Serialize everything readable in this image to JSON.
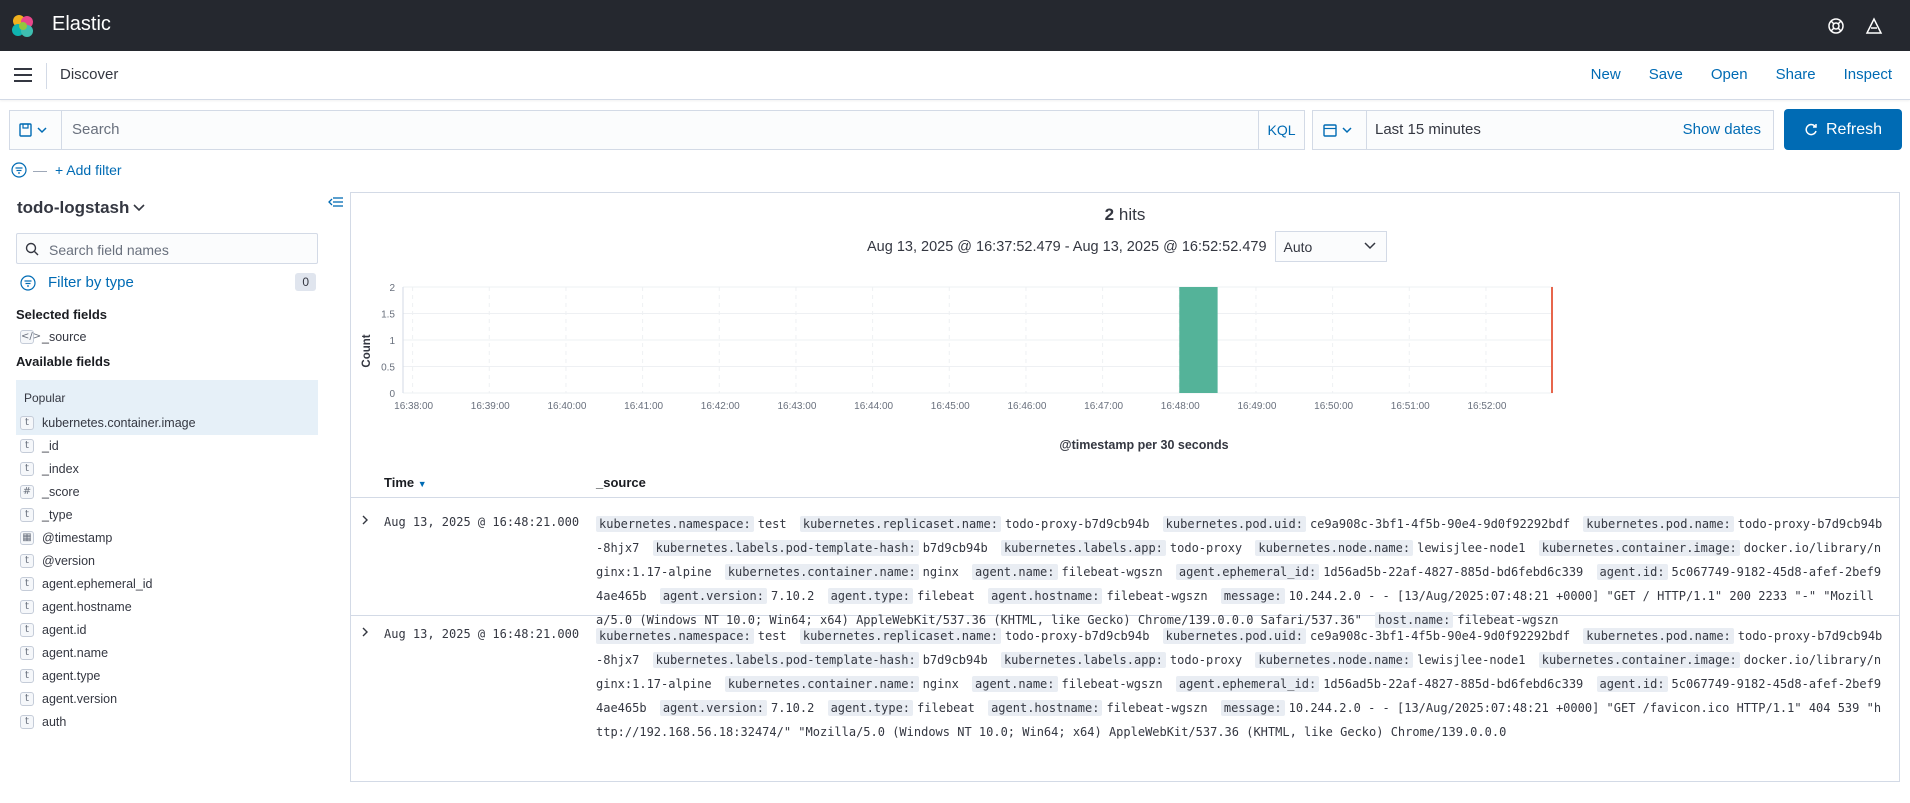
{
  "header": {
    "app_title": "Elastic"
  },
  "nav": {
    "breadcrumb": "Discover",
    "links": [
      "New",
      "Save",
      "Open",
      "Share",
      "Inspect"
    ]
  },
  "query": {
    "placeholder": "Search",
    "language": "KQL"
  },
  "time": {
    "range_label": "Last 15 minutes",
    "show_dates": "Show dates",
    "refresh": "Refresh"
  },
  "filters": {
    "add_label": "+ Add filter"
  },
  "sidebar": {
    "index_pattern": "todo-logstash",
    "search_placeholder": "Search field names",
    "filter_by_type": "Filter by type",
    "filter_count": "0",
    "selected_title": "Selected fields",
    "selected_fields": [
      {
        "type": "source",
        "name": "_source"
      }
    ],
    "available_title": "Available fields",
    "popular_title": "Popular",
    "popular_fields": [
      {
        "type": "t",
        "name": "kubernetes.container.image"
      }
    ],
    "fields": [
      {
        "type": "t",
        "name": "_id"
      },
      {
        "type": "t",
        "name": "_index"
      },
      {
        "type": "#",
        "name": "_score"
      },
      {
        "type": "t",
        "name": "_type"
      },
      {
        "type": "date",
        "name": "@timestamp"
      },
      {
        "type": "t",
        "name": "@version"
      },
      {
        "type": "t",
        "name": "agent.ephemeral_id"
      },
      {
        "type": "t",
        "name": "agent.hostname"
      },
      {
        "type": "t",
        "name": "agent.id"
      },
      {
        "type": "t",
        "name": "agent.name"
      },
      {
        "type": "t",
        "name": "agent.type"
      },
      {
        "type": "t",
        "name": "agent.version"
      },
      {
        "type": "t",
        "name": "auth"
      }
    ]
  },
  "results": {
    "hits_count": "2",
    "hits_label": "hits",
    "time_range": "Aug 13, 2025 @ 16:37:52.479 - Aug 13, 2025 @ 16:52:52.479",
    "interval": "Auto",
    "columns": {
      "time": "Time",
      "source": "_source"
    },
    "rows": [
      {
        "time": "Aug 13, 2025 @ 16:48:21.000",
        "fields": [
          [
            "kubernetes.namespace:",
            "test"
          ],
          [
            "kubernetes.replicaset.name:",
            "todo-proxy-b7d9cb94b"
          ],
          [
            "kubernetes.pod.uid:",
            "ce9a908c-3bf1-4f5b-90e4-9d0f92292bdf"
          ],
          [
            "kubernetes.pod.name:",
            "todo-proxy-b7d9cb94b-8hjx7"
          ],
          [
            "kubernetes.labels.pod-template-hash:",
            "b7d9cb94b"
          ],
          [
            "kubernetes.labels.app:",
            "todo-proxy"
          ],
          [
            "kubernetes.node.name:",
            "lewisjlee-node1"
          ],
          [
            "kubernetes.container.image:",
            "docker.io/library/nginx:1.17-alpine"
          ],
          [
            "kubernetes.container.name:",
            "nginx"
          ],
          [
            "agent.name:",
            "filebeat-wgszn"
          ],
          [
            "agent.ephemeral_id:",
            "1d56ad5b-22af-4827-885d-bd6febd6c339"
          ],
          [
            "agent.id:",
            "5c067749-9182-45d8-afef-2bef94ae465b"
          ],
          [
            "agent.version:",
            "7.10.2"
          ],
          [
            "agent.type:",
            "filebeat"
          ],
          [
            "agent.hostname:",
            "filebeat-wgszn"
          ],
          [
            "message:",
            "10.244.2.0 - - [13/Aug/2025:07:48:21 +0000] \"GET / HTTP/1.1\" 200 2233 \"-\" \"Mozilla/5.0 (Windows NT 10.0; Win64; x64) AppleWebKit/537.36 (KHTML, like Gecko) Chrome/139.0.0.0 Safari/537.36\""
          ],
          [
            "host.name:",
            "filebeat-wgszn"
          ]
        ]
      },
      {
        "time": "Aug 13, 2025 @ 16:48:21.000",
        "fields": [
          [
            "kubernetes.namespace:",
            "test"
          ],
          [
            "kubernetes.replicaset.name:",
            "todo-proxy-b7d9cb94b"
          ],
          [
            "kubernetes.pod.uid:",
            "ce9a908c-3bf1-4f5b-90e4-9d0f92292bdf"
          ],
          [
            "kubernetes.pod.name:",
            "todo-proxy-b7d9cb94b-8hjx7"
          ],
          [
            "kubernetes.labels.pod-template-hash:",
            "b7d9cb94b"
          ],
          [
            "kubernetes.labels.app:",
            "todo-proxy"
          ],
          [
            "kubernetes.node.name:",
            "lewisjlee-node1"
          ],
          [
            "kubernetes.container.image:",
            "docker.io/library/nginx:1.17-alpine"
          ],
          [
            "kubernetes.container.name:",
            "nginx"
          ],
          [
            "agent.name:",
            "filebeat-wgszn"
          ],
          [
            "agent.ephemeral_id:",
            "1d56ad5b-22af-4827-885d-bd6febd6c339"
          ],
          [
            "agent.id:",
            "5c067749-9182-45d8-afef-2bef94ae465b"
          ],
          [
            "agent.version:",
            "7.10.2"
          ],
          [
            "agent.type:",
            "filebeat"
          ],
          [
            "agent.hostname:",
            "filebeat-wgszn"
          ],
          [
            "message:",
            "10.244.2.0 - - [13/Aug/2025:07:48:21 +0000] \"GET /favicon.ico HTTP/1.1\" 404 539 \"http://192.168.56.18:32474/\" \"Mozilla/5.0 (Windows NT 10.0; Win64; x64) AppleWebKit/537.36 (KHTML, like Gecko) Chrome/139.0.0.0"
          ]
        ]
      }
    ]
  },
  "colors": {
    "accent": "#006bb4",
    "bar": "#54b399",
    "now_line": "#e7664c",
    "header_bg": "#25282f"
  },
  "chart_data": {
    "type": "bar",
    "xlabel": "@timestamp per 30 seconds",
    "ylabel": "Count",
    "ylim": [
      0,
      2
    ],
    "yticks": [
      "0",
      "0.5",
      "1",
      "1.5",
      "2"
    ],
    "xticks": [
      "16:38:00",
      "16:39:00",
      "16:40:00",
      "16:41:00",
      "16:42:00",
      "16:43:00",
      "16:44:00",
      "16:45:00",
      "16:46:00",
      "16:47:00",
      "16:48:00",
      "16:49:00",
      "16:50:00",
      "16:51:00",
      "16:52:00"
    ],
    "x_range": [
      "16:37:52.479",
      "16:52:52.479"
    ],
    "bars": [
      {
        "x": "16:48:00",
        "value": 2
      }
    ],
    "now_marker": "16:52:52.479"
  }
}
